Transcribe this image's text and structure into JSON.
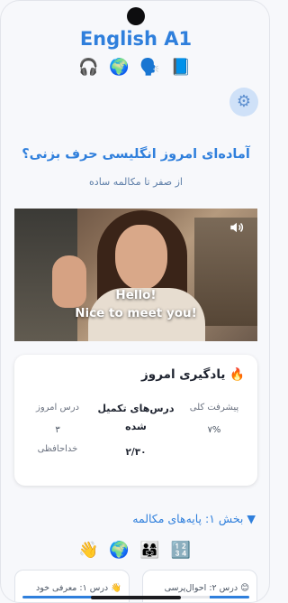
{
  "app": {
    "title": "English A1",
    "header_icons": [
      "🎧",
      "🌍",
      "🗣️",
      "📘"
    ],
    "settings_icon": "⚙"
  },
  "hero": {
    "title": "آماده‌ای امروز انگلیسی حرف بزنی؟",
    "subtitle": "از صفر تا مکالمه ساده"
  },
  "video": {
    "caption_line1": "Hello!",
    "caption_line2": "Nice to meet you!"
  },
  "learning": {
    "title": "🔥 یادگیری امروز",
    "stats": [
      {
        "label": "پیشرفت کلی",
        "value": "۷%",
        "sub": ""
      },
      {
        "label": "درس‌های تکمیل شده",
        "value": "۲/۳۰",
        "sub": ""
      },
      {
        "label": "درس امروز",
        "value": "۳",
        "sub": "خداحافظی"
      }
    ]
  },
  "section": {
    "title": "▼ بخش ۱: پایه‌های مکالمه",
    "icons": [
      "👋",
      "🌍",
      "👨‍👩‍👧",
      "🔢"
    ]
  },
  "lessons": [
    {
      "label": "😊 درس ۲: احوال‌پرسی",
      "progress": 0.4
    },
    {
      "label": "👋 درس ۱: معرفی خود",
      "progress": 1.0
    }
  ],
  "colors": {
    "accent": "#2f7fdc",
    "background": "#f7f8fb",
    "card": "#ffffff"
  }
}
